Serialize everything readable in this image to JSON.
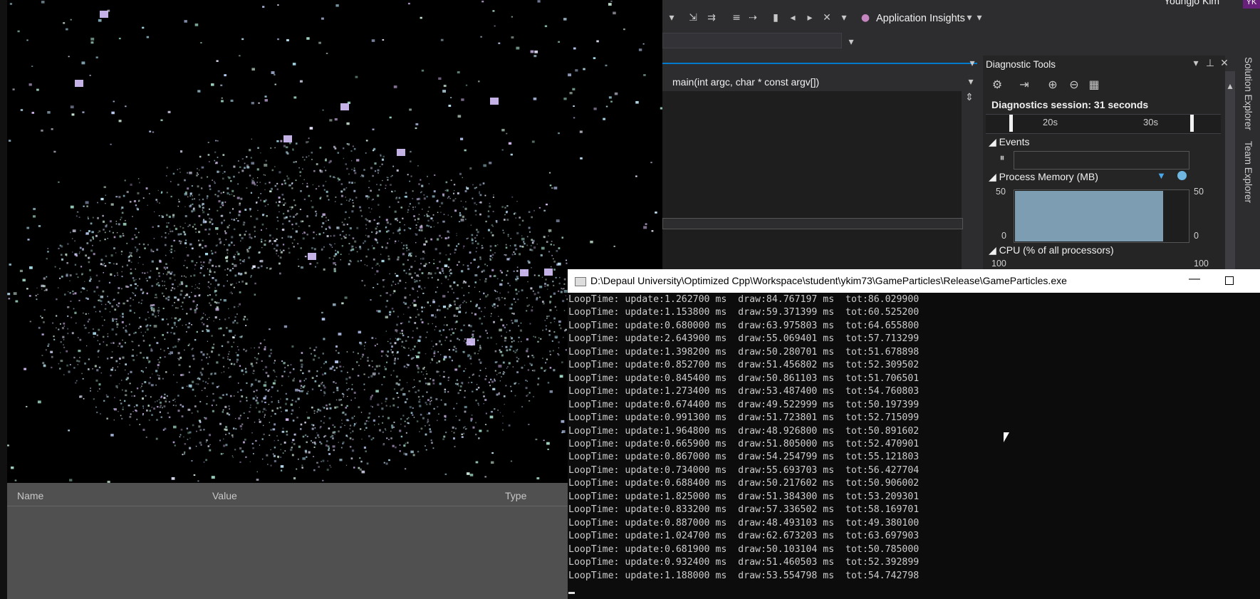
{
  "toolbar": {
    "application_insights": "Application Insights",
    "user_name": "Youngjo Kim",
    "user_initials": "YK"
  },
  "editor": {
    "member_label": "main(int argc, char * const argv[])"
  },
  "diagnostics": {
    "title": "Diagnostic Tools",
    "session": "Diagnostics session: 31 seconds",
    "timeline_labels": [
      "20s",
      "30s"
    ],
    "events_label": "Events",
    "memory_label": "Process Memory (MB)",
    "memory_axis_top": "50",
    "memory_axis_bottom": "0",
    "cpu_label": "CPU (% of all processors)",
    "cpu_axis_top": "100"
  },
  "side_tabs": [
    "Solution Explorer",
    "Team Explorer"
  ],
  "locals": {
    "columns": [
      "Name",
      "Value",
      "Type"
    ]
  },
  "console": {
    "title": "D:\\Depaul University\\Optimized Cpp\\Workspace\\student\\ykim73\\GameParticles\\Release\\GameParticles.exe",
    "lines": [
      "LoopTime: update:1.262700 ms  draw:84.767197 ms  tot:86.029900",
      "LoopTime: update:1.153800 ms  draw:59.371399 ms  tot:60.525200",
      "LoopTime: update:0.680000 ms  draw:63.975803 ms  tot:64.655800",
      "LoopTime: update:2.643900 ms  draw:55.069401 ms  tot:57.713299",
      "LoopTime: update:1.398200 ms  draw:50.280701 ms  tot:51.678898",
      "LoopTime: update:0.852700 ms  draw:51.456802 ms  tot:52.309502",
      "LoopTime: update:0.845400 ms  draw:50.861103 ms  tot:51.706501",
      "LoopTime: update:1.273400 ms  draw:53.487400 ms  tot:54.760803",
      "LoopTime: update:0.674400 ms  draw:49.522999 ms  tot:50.197399",
      "LoopTime: update:0.991300 ms  draw:51.723801 ms  tot:52.715099",
      "LoopTime: update:1.964800 ms  draw:48.926800 ms  tot:50.891602",
      "LoopTime: update:0.665900 ms  draw:51.805000 ms  tot:52.470901",
      "LoopTime: update:0.867000 ms  draw:54.254799 ms  tot:55.121803",
      "LoopTime: update:0.734000 ms  draw:55.693703 ms  tot:56.427704",
      "LoopTime: update:0.688400 ms  draw:50.217602 ms  tot:50.906002",
      "LoopTime: update:1.825000 ms  draw:51.384300 ms  tot:53.209301",
      "LoopTime: update:0.833200 ms  draw:57.336502 ms  tot:58.169701",
      "LoopTime: update:0.887000 ms  draw:48.493103 ms  tot:49.380100",
      "LoopTime: update:1.024700 ms  draw:62.673203 ms  tot:63.697903",
      "LoopTime: update:0.681900 ms  draw:50.103104 ms  tot:50.785000",
      "LoopTime: update:0.932400 ms  draw:51.460503 ms  tot:52.392899",
      "LoopTime: update:1.188000 ms  draw:53.554798 ms  tot:54.742798"
    ]
  },
  "colors": {
    "accent": "#007acc",
    "avatar": "#68217a",
    "memory_fill": "#7d9db3",
    "console_bg": "#0c0c0c"
  }
}
